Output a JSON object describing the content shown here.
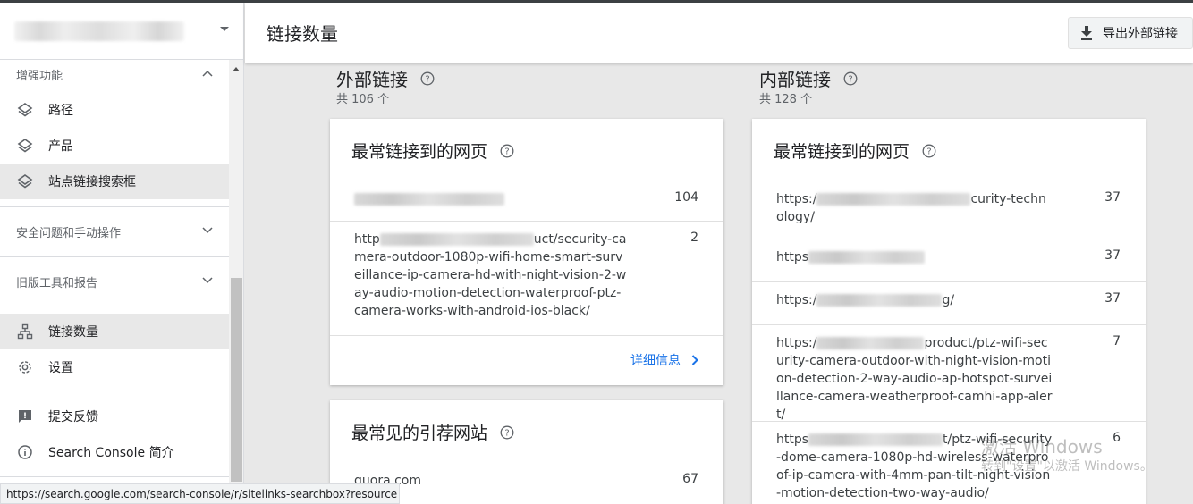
{
  "sidebar": {
    "sections": [
      {
        "label": "增强功能",
        "items": [
          {
            "label": "路径",
            "icon": "layers-icon"
          },
          {
            "label": "产品",
            "icon": "layers-icon"
          },
          {
            "label": "站点链接搜索框",
            "icon": "layers-icon",
            "active": true
          }
        ]
      },
      {
        "label": "安全问题和手动操作"
      },
      {
        "label": "旧版工具和报告"
      }
    ],
    "bottom_items": [
      {
        "label": "链接数量",
        "icon": "sitemap-icon",
        "active": true
      },
      {
        "label": "设置",
        "icon": "gear-icon"
      },
      {
        "label": "提交反馈",
        "icon": "feedback-icon"
      },
      {
        "label": "Search Console 简介",
        "icon": "info-icon"
      }
    ]
  },
  "status_url": "https://search.google.com/search-console/r/sitelinks-searchbox?resource_i...",
  "header": {
    "title": "链接数量",
    "export_label": "导出外部链接"
  },
  "external": {
    "title": "外部链接",
    "total": "共 106 个",
    "top_pages": {
      "title": "最常链接到的网页",
      "rows": [
        {
          "prefix": "",
          "suffix": "",
          "count": "104"
        },
        {
          "prefix": "http",
          "suffix": "uct/security-camera-outdoor-1080p-wifi-home-smart-surveillance-ip-camera-hd-with-night-vision-2-way-audio-motion-detection-waterproof-ptz-camera-works-with-android-ios-black/",
          "count": "2"
        }
      ],
      "detail_label": "详细信息"
    },
    "top_sites": {
      "title": "最常见的引荐网站",
      "rows": [
        {
          "site": "quora.com",
          "count": "67"
        }
      ]
    }
  },
  "internal": {
    "title": "内部链接",
    "total": "共 128 个",
    "top_pages": {
      "title": "最常链接到的网页",
      "rows": [
        {
          "prefix": "https:/",
          "suffix": "curity-technology/",
          "count": "37"
        },
        {
          "prefix": "https",
          "suffix": "",
          "count": "37"
        },
        {
          "prefix": "https:/",
          "suffix": "g/",
          "count": "37"
        },
        {
          "prefix": "https:/",
          "suffix": "product/ptz-wifi-security-camera-outdoor-with-night-vision-motion-detection-2-way-audio-ap-hotspot-surveillance-camera-weatherproof-camhi-app-alert/",
          "count": "7"
        },
        {
          "prefix": "https",
          "suffix": "t/ptz-wifi-security-dome-camera-1080p-hd-wireless-waterproof-ip-camera-with-4mm-pan-tilt-night-vision-motion-detection-two-way-audio/",
          "count": "6"
        }
      ]
    }
  },
  "watermark": {
    "line1": "激活 Windows",
    "line2": "转到\"设置\"以激活 Windows。"
  }
}
